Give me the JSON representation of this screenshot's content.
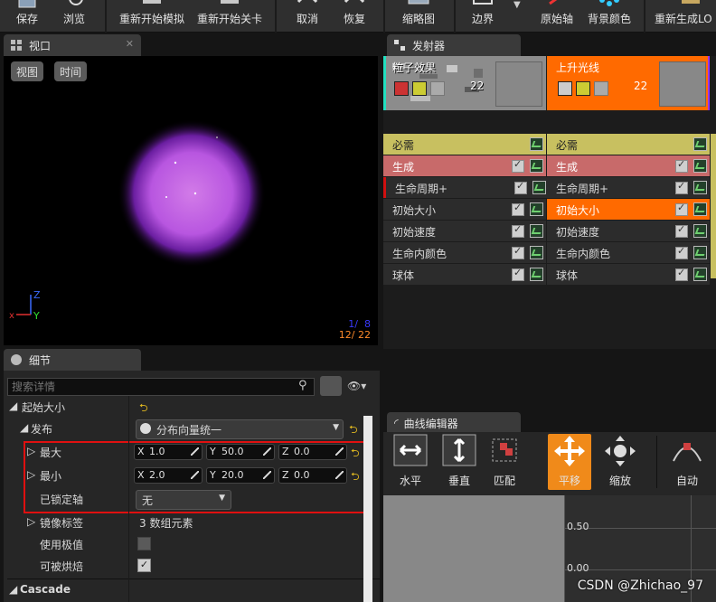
{
  "toolbar": {
    "save": "保存",
    "browse": "浏览",
    "restart_sim": "重新开始模拟",
    "restart_level": "重新开始关卡",
    "undo": "取消",
    "redo": "恢复",
    "thumbnail": "缩略图",
    "bounds": "边界",
    "origin_axis": "原始轴",
    "bg_color": "背景颜色",
    "regen_lod": "重新生成LO"
  },
  "viewport": {
    "tab": "视口",
    "view_btn": "视图",
    "time_btn": "时间",
    "counter1": "1/  8",
    "counter2": "12/ 22"
  },
  "emitters": {
    "tab": "发射器",
    "items": [
      {
        "name": "粒子效果",
        "count": "22",
        "modules": [
          "必需",
          "生成",
          "生命周期+",
          "初始大小",
          "初始速度",
          "生命内颜色",
          "球体"
        ]
      },
      {
        "name": "上升光线",
        "count": "22",
        "modules": [
          "必需",
          "生成",
          "生命周期+",
          "初始大小",
          "初始速度",
          "生命内颜色",
          "球体"
        ]
      }
    ],
    "colors": {
      "required": "#c8c060",
      "spawn": "#c86a6a",
      "selected": "#ff6a00"
    }
  },
  "details": {
    "tab": "细节",
    "search_placeholder": "搜索详情",
    "category": "起始大小",
    "distribution_label": "发布",
    "distribution_value": "分布向量统一",
    "max_label": "最大",
    "max": {
      "x": "1.0",
      "y": "50.0",
      "z": "0.0"
    },
    "min_label": "最小",
    "min": {
      "x": "2.0",
      "y": "20.0",
      "z": "0.0"
    },
    "locked_axes_label": "已锁定轴",
    "locked_axes_value": "无",
    "mirror_label": "镜像标签",
    "mirror_value": "3 数组元素",
    "use_extremes_label": "使用极值",
    "use_extremes": false,
    "bakeable_label": "可被烘焙",
    "bakeable": true,
    "cascade_label": "Cascade",
    "axis_x": "X",
    "axis_y": "Y",
    "axis_z": "Z"
  },
  "curve_editor": {
    "tab": "曲线编辑器",
    "buttons": [
      "水平",
      "垂直",
      "匹配",
      "平移",
      "缩放",
      "自动"
    ],
    "y_labels": [
      "0.50",
      "0.00"
    ]
  },
  "watermark": "CSDN @Zhichao_97"
}
